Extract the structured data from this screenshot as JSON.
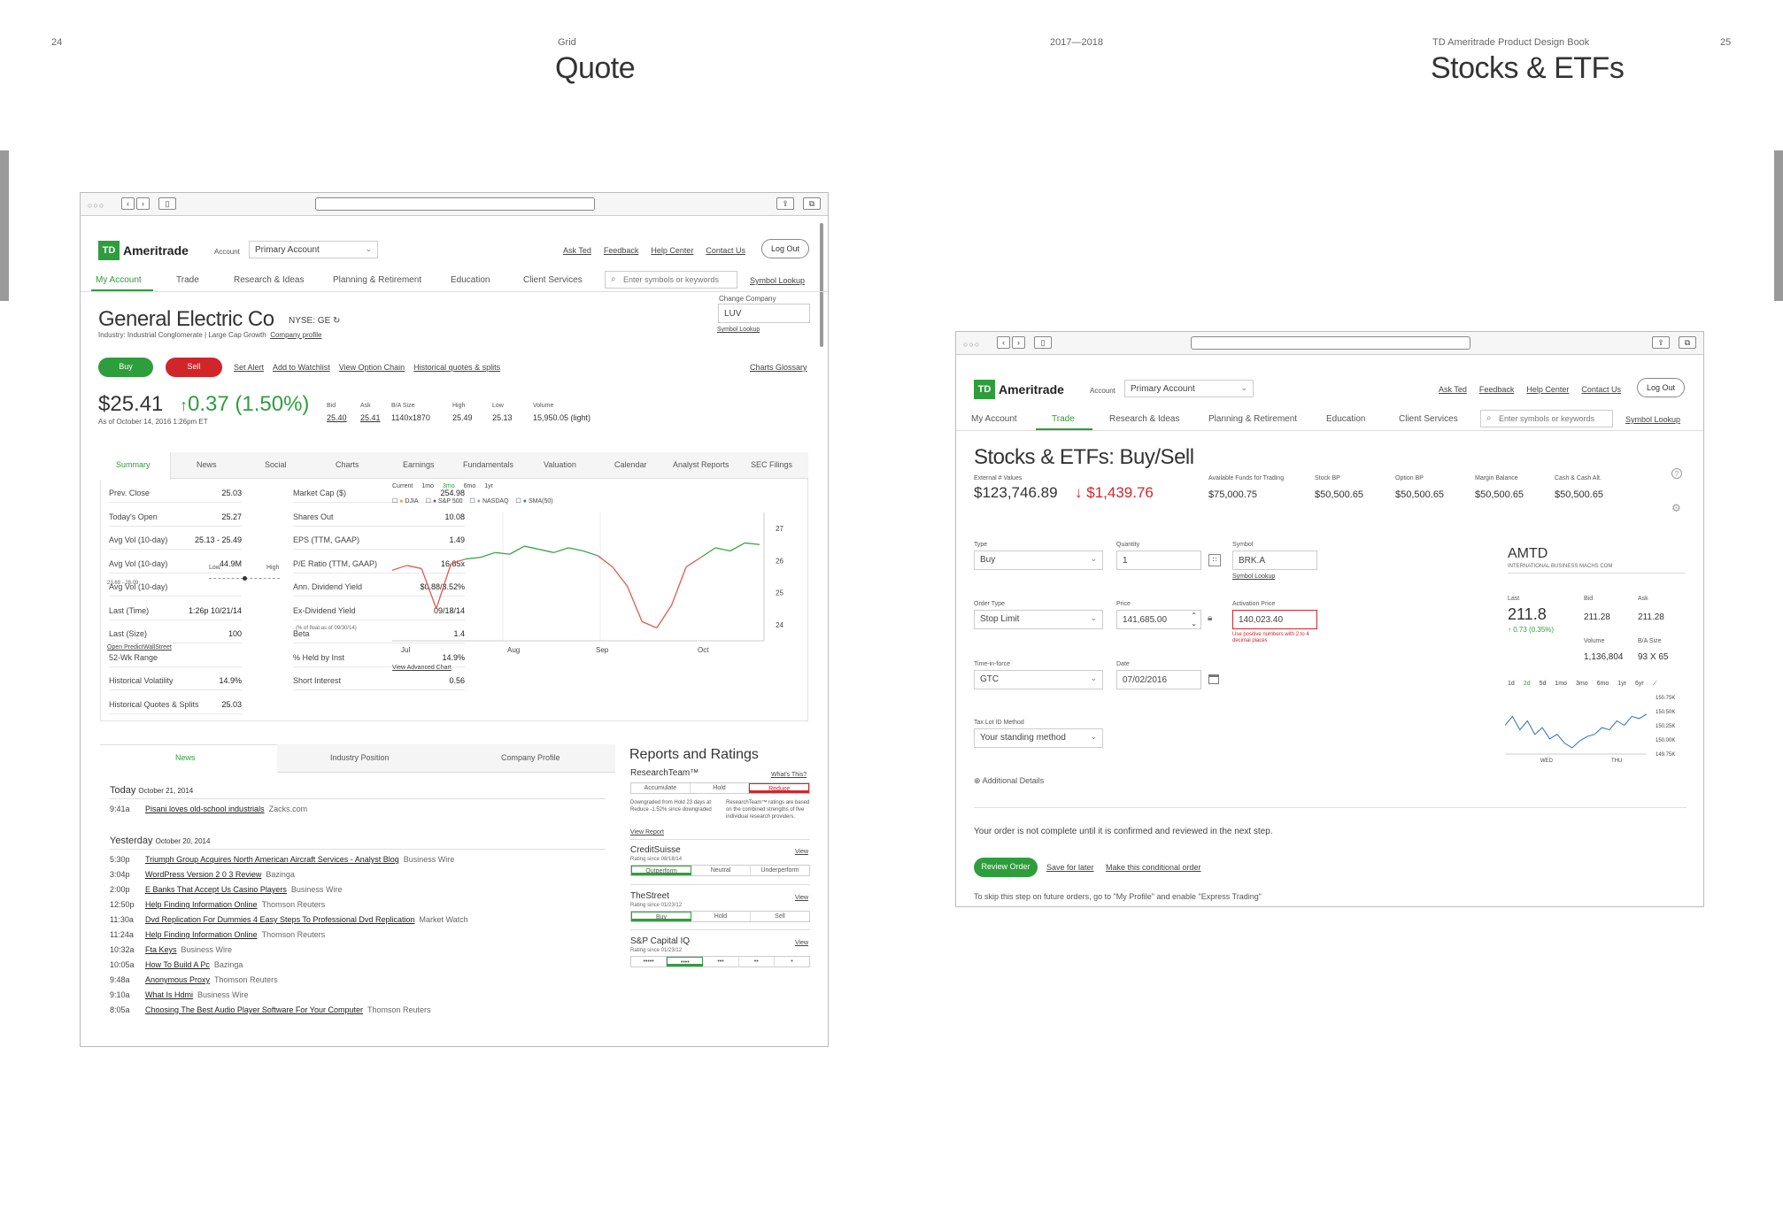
{
  "spread": {
    "left_page_num": "24",
    "left_section": "Grid",
    "left_title": "Quote",
    "center_label": "2017—2018",
    "right_section": "TD Ameritrade Product Design Book",
    "right_page_num": "25",
    "right_title": "Stocks & ETFs"
  },
  "quote": {
    "logo": {
      "mark": "TD",
      "name": "Ameritrade"
    },
    "account_label": "Account",
    "account_value": "Primary Account",
    "top_links": [
      "Ask Ted",
      "Feedback",
      "Help Center",
      "Contact Us"
    ],
    "logout": "Log Out",
    "nav": [
      "My Account",
      "Trade",
      "Research & Ideas",
      "Planning & Retirement",
      "Education",
      "Client Services"
    ],
    "search_placeholder": "Enter symbols or keywords",
    "symbol_lookup": "Symbol Lookup",
    "company": "General Electric Co",
    "exchange": "NYSE: GE",
    "industry": "Industry: Industrial Conglomerate | Large Cap Growth",
    "company_profile": "Company profile",
    "change_company_label": "Change Company",
    "change_company_value": "LUV",
    "change_symbol_lookup": "Symbol Lookup",
    "buy": "Buy",
    "sell": "Sell",
    "actions": [
      "Set Alert",
      "Add to Watchlist",
      "View Option Chain",
      "Historical quotes & splits"
    ],
    "charts_glossary": "Charts Glossary",
    "price": "$25.41",
    "change": "0.37 (1.50%)",
    "as_of": "As of October 14, 2016 1:26pm ET",
    "quote_stats": [
      {
        "label": "Bid",
        "value": "25.40"
      },
      {
        "label": "Ask",
        "value": "25.41"
      },
      {
        "label": "B/A Size",
        "value": "1140x1870"
      },
      {
        "label": "High",
        "value": "25.49"
      },
      {
        "label": "Low",
        "value": "25.13"
      },
      {
        "label": "Volume",
        "value": "15,950.05 (light)"
      }
    ],
    "tabs": [
      "Summary",
      "News",
      "Social",
      "Charts",
      "Earnings",
      "Fundamentals",
      "Valuation",
      "Calendar",
      "Analyst Reports",
      "SEC Filings"
    ],
    "summary_left": [
      {
        "label": "Prev. Close",
        "value": "25.03"
      },
      {
        "label": "Today's Open",
        "value": "25.27"
      },
      {
        "label": "Avg Vol (10-day)",
        "value": "25.13 - 25.49"
      },
      {
        "label": "Avg Vol (10-day)",
        "value": "44.9M"
      },
      {
        "label": "Avg Vol (10-day)",
        "value": ""
      },
      {
        "label": "Last (Time)",
        "value": "1:26p 10/21/14"
      },
      {
        "label": "Last (Size)",
        "value": "100"
      },
      {
        "label": "52-Wk Range",
        "value": ""
      },
      {
        "label": "Historical Volatility",
        "value": "14.9%"
      },
      {
        "label": "Historical Quotes & Splits",
        "value": "25.03"
      }
    ],
    "range_sub": "23.69 - 28.09",
    "range_low": "Low",
    "range_high": "High",
    "summary_right": [
      {
        "label": "Market Cap ($)",
        "value": "254.98"
      },
      {
        "label": "Shares Out",
        "value": "10.08"
      },
      {
        "label": "EPS (TTM, GAAP)",
        "value": "1.49"
      },
      {
        "label": "P/E Ratio (TTM, GAAP)",
        "value": "16.85x"
      },
      {
        "label": "Ann. Dividend Yield",
        "value": "$0.88/3.52%"
      },
      {
        "label": "Ex-Dividend Yield",
        "value": "09/18/14"
      },
      {
        "label": "Beta",
        "value": "1.4"
      },
      {
        "label": "% Held by Inst",
        "value": "14.9%"
      },
      {
        "label": "Short Interest",
        "value": "0.56"
      }
    ],
    "short_interest_sub": "(% of float as of 09/30/14)",
    "open_predict": "Open PredictWallStreet",
    "chart_ranges": [
      "Current",
      "1mo",
      "3mo",
      "6mo",
      "1yr"
    ],
    "chart_compare": [
      "DJIA",
      "S&P 500",
      "NASDAQ",
      "SMA(50)"
    ],
    "view_advanced": "View Advanced Chart",
    "news_tabs": [
      "News",
      "Industry Position",
      "Company Profile"
    ],
    "today_label": "Today",
    "today_date": "October 21, 2014",
    "today_news": [
      {
        "time": "9:41a",
        "headline": "Pisani loves old-school industrials",
        "source": "Zacks.com"
      }
    ],
    "yesterday_label": "Yesterday",
    "yesterday_date": "October 20, 2014",
    "yesterday_news": [
      {
        "time": "5:30p",
        "headline": "Triumph Group Acquires North American Aircraft Services - Analyst Blog",
        "source": "Business Wire"
      },
      {
        "time": "3:04p",
        "headline": "WordPress Version 2 0 3 Review",
        "source": "Bazinga"
      },
      {
        "time": "2:00p",
        "headline": "E Banks That Accept Us Casino Players",
        "source": "Business Wire"
      },
      {
        "time": "12:50p",
        "headline": "Help Finding Information Online",
        "source": "Thomson Reuters"
      },
      {
        "time": "11:30a",
        "headline": "Dvd Replication For Dummies 4 Easy Steps To Professional Dvd Replication",
        "source": "Market Watch"
      },
      {
        "time": "11:24a",
        "headline": "Help Finding Information Online",
        "source": "Thomson Reuters"
      },
      {
        "time": "10:32a",
        "headline": "Fta Keys",
        "source": "Business Wire"
      },
      {
        "time": "10:05a",
        "headline": "How To Build A Pc",
        "source": "Bazinga"
      },
      {
        "time": "9:48a",
        "headline": "Anonymous Proxy",
        "source": "Thomson Reuters"
      },
      {
        "time": "9:10a",
        "headline": "What Is Hdmi",
        "source": "Business Wire"
      },
      {
        "time": "8:05a",
        "headline": "Choosing The Best Audio Player Software For Your Computer",
        "source": "Thomson Reuters"
      }
    ],
    "reports_title": "Reports and Ratings",
    "research_team": "ResearchTeam™",
    "whats_this": "What's This?",
    "rt_options": [
      "Accumulate",
      "Hold",
      "Reduce"
    ],
    "rt_note_left": "Downgraded from Hold 23 days at Reduce -1.52% since downgraded",
    "rt_note_right": "ResearchTeam™ ratings are based on the combined strengths of five individual research providers.",
    "view_report": "View Report",
    "providers": [
      {
        "name": "CreditSuisse",
        "view": "View",
        "since": "Rating since 08/18/14",
        "options": [
          "Outperform",
          "Neutral",
          "Underperform"
        ]
      },
      {
        "name": "TheStreet",
        "view": "View",
        "since": "Rating since 01/23/12",
        "options": [
          "Buy",
          "Hold",
          "Sell"
        ]
      },
      {
        "name": "S&P Capital IQ",
        "view": "View",
        "since": "Rating since 01/23/12",
        "options": [
          "•••••",
          "••••",
          "•••",
          "••",
          "•"
        ]
      }
    ]
  },
  "chart_data": [
    {
      "type": "line",
      "title": "",
      "x_ticks": [
        "Jul",
        "Aug",
        "Sep",
        "Oct"
      ],
      "ylim": [
        23.5,
        27.5
      ],
      "y_ticks": [
        24,
        25,
        26,
        27
      ],
      "series": [
        {
          "values": [
            25.7,
            25.85,
            25.75,
            24.5,
            25.9,
            26.05,
            26.1,
            26.25,
            26.2,
            26.45,
            26.35,
            26.25,
            26.4,
            26.3,
            26.15,
            25.8,
            25.2,
            24.1,
            23.9,
            24.6,
            25.8,
            26.1,
            26.4,
            26.3,
            26.55,
            26.5
          ]
        }
      ]
    },
    {
      "type": "line",
      "title": "",
      "x_ticks": [
        "WED",
        "THU"
      ],
      "ylim": [
        149.5,
        150.8
      ],
      "y_ticks": [
        "149.75K",
        "150.00K",
        "150.25K",
        "150.50K",
        "150.75K"
      ],
      "series": [
        {
          "values": [
            150.1,
            150.3,
            150.0,
            150.2,
            149.9,
            150.05,
            149.8,
            149.9,
            149.7,
            149.6,
            149.75,
            149.85,
            149.9,
            150.05,
            150.0,
            150.2,
            150.1,
            150.3,
            150.25,
            150.35
          ]
        }
      ]
    }
  ],
  "trade": {
    "logo": {
      "mark": "TD",
      "name": "Ameritrade"
    },
    "account_label": "Account",
    "account_value": "Primary Account",
    "top_links": [
      "Ask Ted",
      "Feedback",
      "Help Center",
      "Contact Us"
    ],
    "logout": "Log Out",
    "nav": [
      "My Account",
      "Trade",
      "Research & Ideas",
      "Planning & Retirement",
      "Education",
      "Client Services"
    ],
    "search_placeholder": "Enter symbols or keywords",
    "symbol_lookup": "Symbol Lookup",
    "title": "Stocks & ETFs: Buy/Sell",
    "ext_label": "External # Values",
    "ext_value": "$123,746.89",
    "ext_change": "$1,439.76",
    "balances": [
      {
        "label": "Available Funds for Trading",
        "value": "$75,000.75"
      },
      {
        "label": "Stock BP",
        "value": "$50,500.65"
      },
      {
        "label": "Option BP",
        "value": "$50,500.65"
      },
      {
        "label": "Margin Balance",
        "value": "$50,500.65"
      },
      {
        "label": "Cash & Cash Alt.",
        "value": "$50,500.65"
      }
    ],
    "type_label": "Type",
    "type_value": "Buy",
    "qty_label": "Quantity",
    "qty_value": "1",
    "symbol_label": "Symbol",
    "symbol_value": "BRK.A",
    "symbol_lookup_link": "Symbol Lookup",
    "order_type_label": "Order Type",
    "order_type_value": "Stop Limit",
    "price_label": "Price",
    "price_value": "141,685.00",
    "activation_label": "Activation Price",
    "activation_value": "140,023.40",
    "activation_error": "Use positive numbers with 2 to 4 decimal places",
    "tif_label": "Time-in-force",
    "tif_value": "GTC",
    "date_label": "Date",
    "date_value": "07/02/2016",
    "taxlot_label": "Tax Lot ID Method",
    "taxlot_value": "Your standing method",
    "additional": "Additional Details",
    "notice": "Your order is not complete until it is confirmed and reviewed in the next step.",
    "review": "Review Order",
    "save_later": "Save for later",
    "conditional": "Make this conditional order",
    "skip_note": "To skip this step on future orders, go to \"My Profile\" and enable \"Express Trading\"",
    "ticker": "AMTD",
    "ticker_name": "INTERNATIONAL BUSINESS MACHS COM",
    "last_label": "Last",
    "last_value": "211.8",
    "last_change": "0.73 (0.35%)",
    "bid_label": "Bid",
    "bid_value": "211.28",
    "ask_label": "Ask",
    "ask_value": "211.28",
    "volume_label": "Volume",
    "volume_value": "1,136,804",
    "ba_label": "B/A Size",
    "ba_value": "93 X 65",
    "ranges": [
      "1d",
      "2d",
      "5d",
      "1mo",
      "3mo",
      "6mo",
      "1yr",
      "6yr"
    ]
  },
  "colors": {
    "green": "#2e9e3c",
    "red": "#d0262b"
  }
}
